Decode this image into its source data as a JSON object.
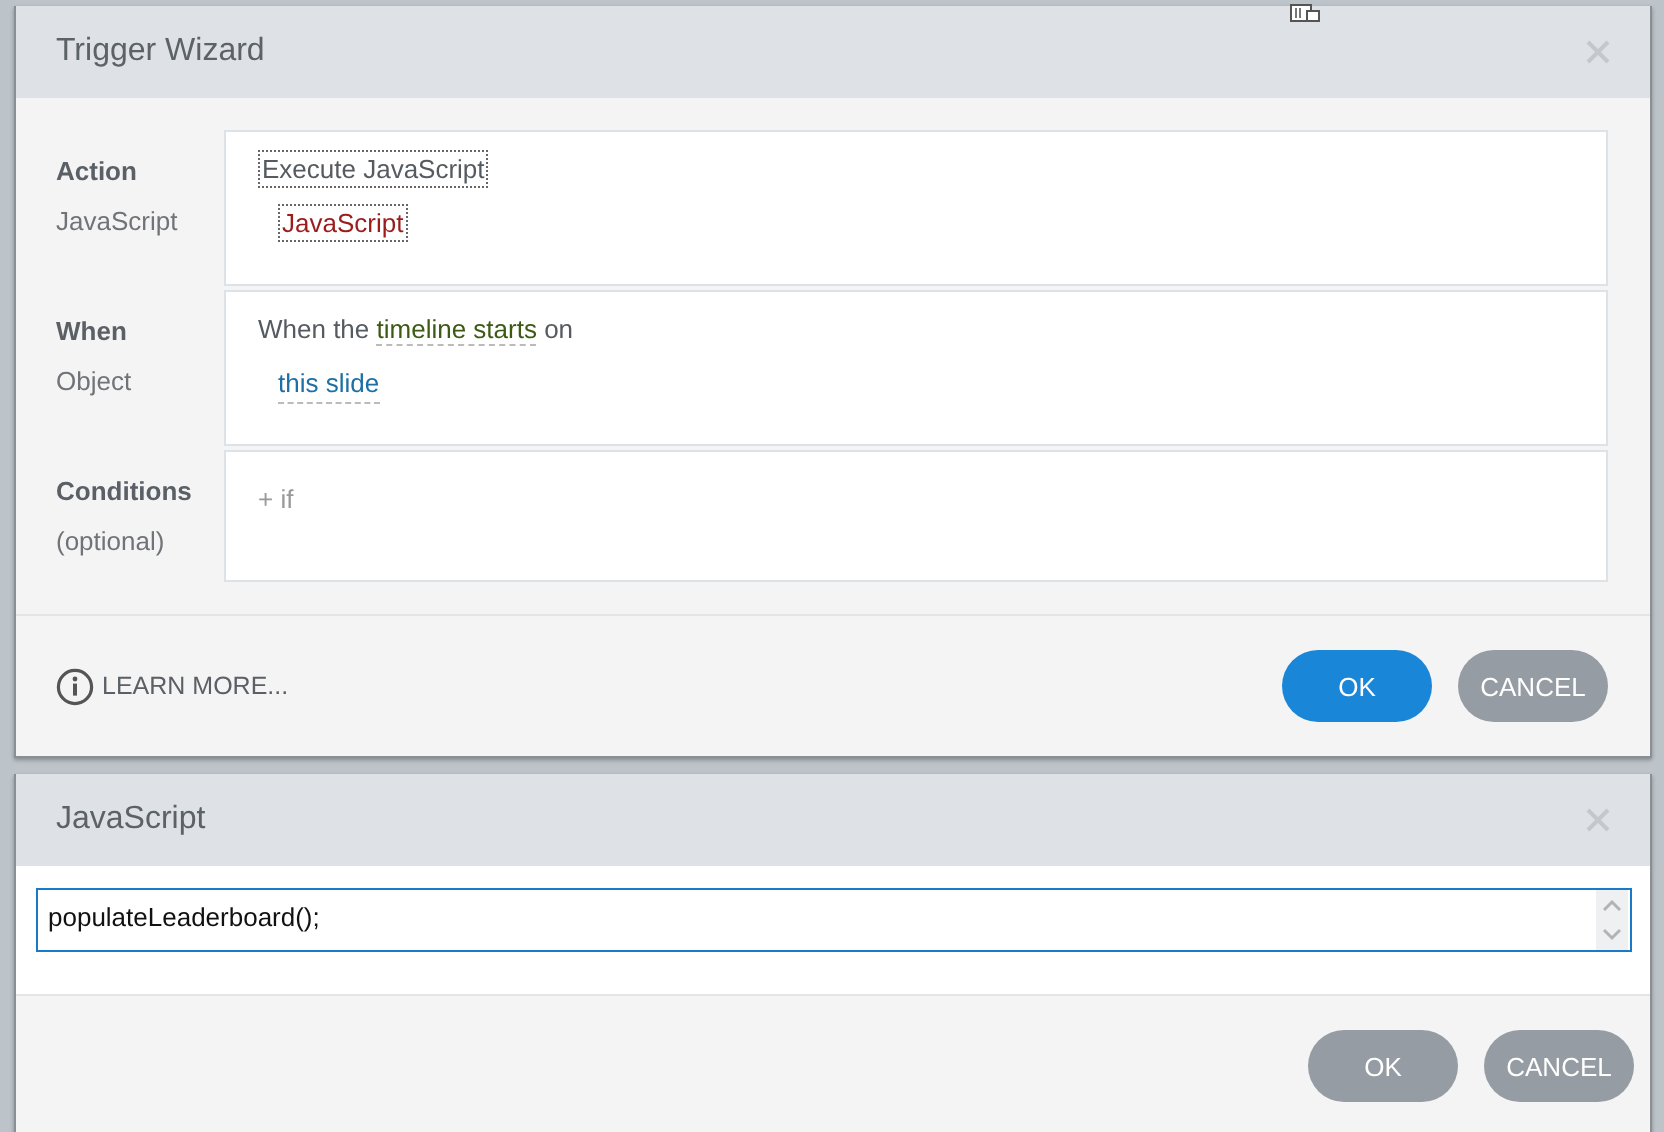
{
  "trigger_wizard": {
    "title": "Trigger Wizard",
    "sections": [
      {
        "label": "Action",
        "sublabel": "JavaScript",
        "lines": [
          [
            {
              "kind": "choice",
              "text": "Execute JavaScript"
            }
          ],
          [
            {
              "kind": "value",
              "text": "JavaScript"
            }
          ]
        ]
      },
      {
        "label": "When",
        "sublabel": "Object",
        "lines": [
          [
            {
              "kind": "text",
              "text": "When the "
            },
            {
              "kind": "event",
              "text": "timeline starts"
            },
            {
              "kind": "text",
              "text": " on"
            }
          ],
          [
            {
              "kind": "target",
              "text": "this slide"
            }
          ]
        ]
      },
      {
        "label": "Conditions",
        "sublabel": "(optional)",
        "lines": [
          [
            {
              "kind": "add",
              "text": "+ if"
            }
          ]
        ]
      }
    ],
    "learn_more": "LEARN MORE...",
    "buttons": [
      {
        "label": "OK",
        "primary": true
      },
      {
        "label": "CANCEL",
        "primary": false
      }
    ]
  },
  "javascript_dialog": {
    "title": "JavaScript",
    "code": "populateLeaderboard();",
    "buttons": [
      {
        "label": "OK",
        "primary": false
      },
      {
        "label": "CANCEL",
        "primary": false
      }
    ]
  }
}
